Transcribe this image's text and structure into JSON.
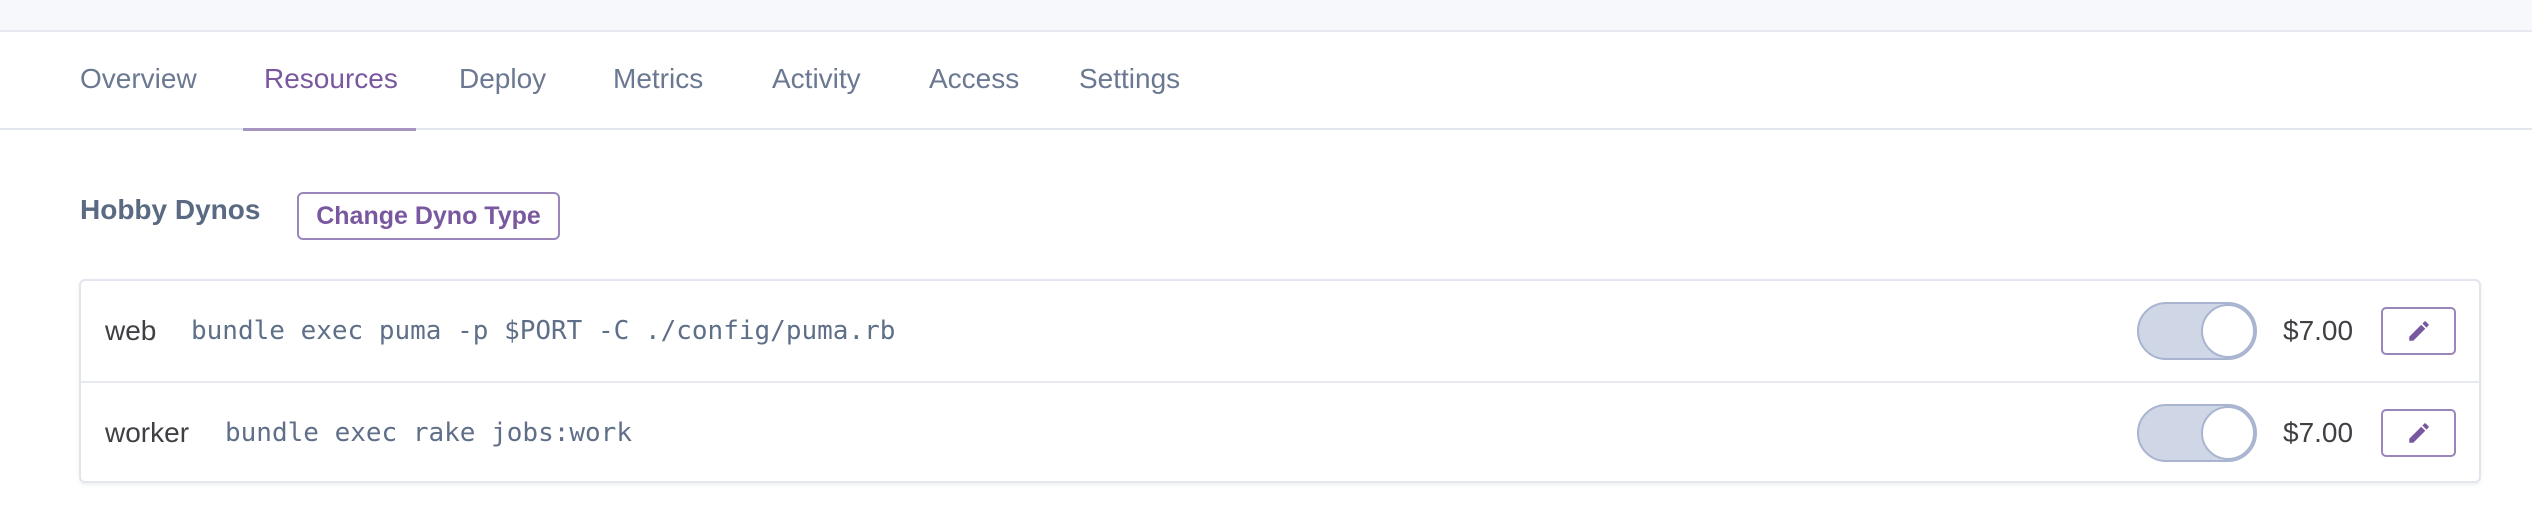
{
  "tabs": [
    {
      "label": "Overview",
      "active": false
    },
    {
      "label": "Resources",
      "active": true
    },
    {
      "label": "Deploy",
      "active": false
    },
    {
      "label": "Metrics",
      "active": false
    },
    {
      "label": "Activity",
      "active": false
    },
    {
      "label": "Access",
      "active": false
    },
    {
      "label": "Settings",
      "active": false
    }
  ],
  "section": {
    "title": "Hobby Dynos",
    "change_button_label": "Change Dyno Type"
  },
  "dynos": [
    {
      "name": "web",
      "command": "bundle exec puma -p $PORT -C ./config/puma.rb",
      "enabled": true,
      "price": "$7.00",
      "edit_icon": "pencil-icon"
    },
    {
      "name": "worker",
      "command": "bundle exec rake jobs:work",
      "enabled": true,
      "price": "$7.00",
      "edit_icon": "pencil-icon"
    }
  ],
  "colors": {
    "accent": "#79589f",
    "text_muted": "#6b7891",
    "toggle_fill": "#cfd6e6"
  }
}
